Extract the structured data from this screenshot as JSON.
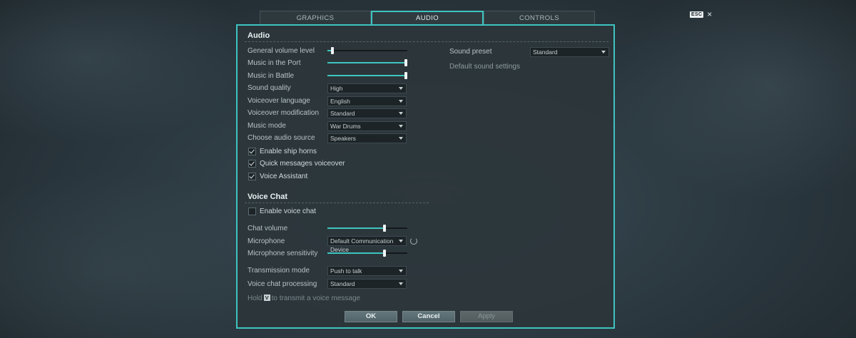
{
  "close": {
    "esc_key": "ESC",
    "close_glyph": "×"
  },
  "tabs": [
    {
      "label": "GRAPHICS",
      "active": false
    },
    {
      "label": "AUDIO",
      "active": true
    },
    {
      "label": "CONTROLS",
      "active": false
    }
  ],
  "audio": {
    "title": "Audio",
    "general_volume": {
      "label": "General volume level",
      "value": 0.05
    },
    "music_port": {
      "label": "Music in the Port",
      "value": 1.0
    },
    "music_battle": {
      "label": "Music in Battle",
      "value": 1.0
    },
    "sound_quality": {
      "label": "Sound quality",
      "value": "High"
    },
    "voiceover_language": {
      "label": "Voiceover language",
      "value": "English"
    },
    "voiceover_mod": {
      "label": "Voiceover modification",
      "value": "Standard"
    },
    "music_mode": {
      "label": "Music mode",
      "value": "War Drums"
    },
    "audio_source": {
      "label": "Choose audio source",
      "value": "Speakers"
    },
    "ship_horns": {
      "label": "Enable ship horns",
      "checked": true
    },
    "quick_messages": {
      "label": "Quick messages voiceover",
      "checked": true
    },
    "voice_assistant": {
      "label": "Voice Assistant",
      "checked": true
    }
  },
  "preset": {
    "label": "Sound preset",
    "value": "Standard",
    "note": "Default sound settings"
  },
  "voice_chat": {
    "title": "Voice Chat",
    "enable": {
      "label": "Enable voice chat",
      "checked": false
    },
    "chat_volume": {
      "label": "Chat volume",
      "value": 0.72
    },
    "microphone": {
      "label": "Microphone",
      "value": "Default Communication Device"
    },
    "mic_sensitivity": {
      "label": "Microphone sensitivity",
      "value": 0.72
    },
    "transmission_mode": {
      "label": "Transmission mode",
      "value": "Push to talk"
    },
    "processing": {
      "label": "Voice chat processing",
      "value": "Standard"
    },
    "hint_before": "Hold",
    "hint_key": "V",
    "hint_after": "to transmit a voice message"
  },
  "buttons": {
    "ok": "OK",
    "cancel": "Cancel",
    "apply": "Apply"
  },
  "colors": {
    "accent": "#3ec4c0"
  }
}
